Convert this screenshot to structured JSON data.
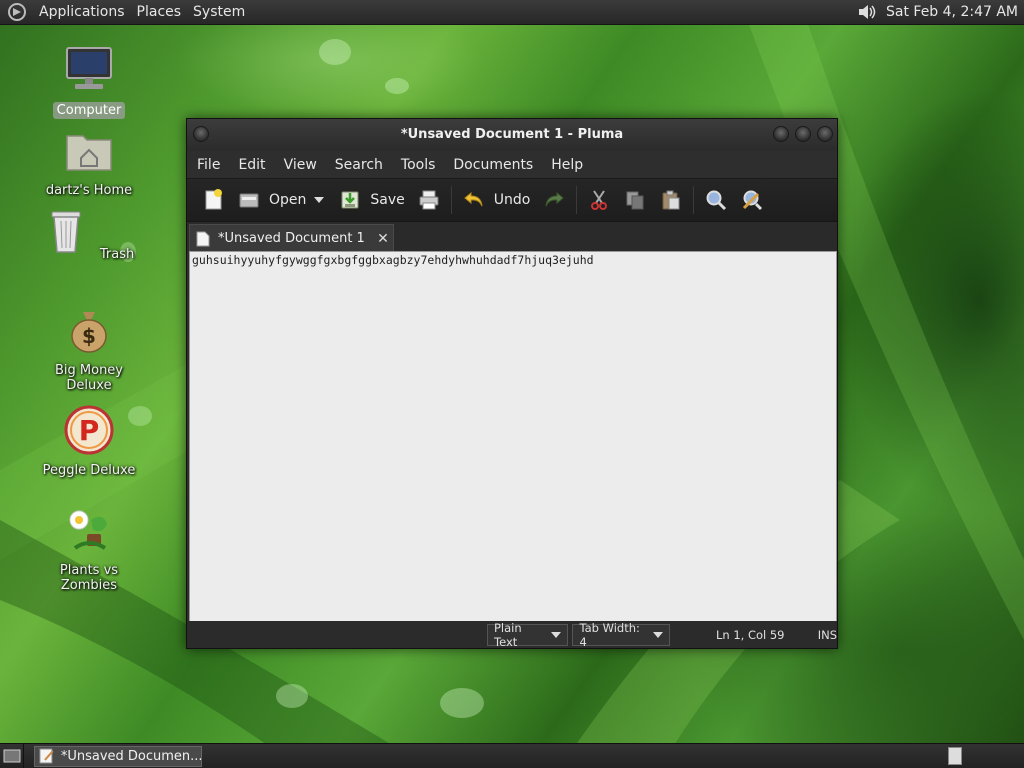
{
  "top_panel": {
    "menus": [
      "Applications",
      "Places",
      "System"
    ],
    "clock": "Sat Feb  4,  2:47 AM"
  },
  "desktop": {
    "icons": [
      {
        "label": "Computer",
        "icon": "computer-icon",
        "selected": true
      },
      {
        "label": "dartz's Home",
        "icon": "home-folder-icon"
      },
      {
        "label": "Trash",
        "icon": "trash-icon"
      },
      {
        "label": "Big Money Deluxe",
        "icon": "money-bag-icon"
      },
      {
        "label": "Peggle Deluxe",
        "icon": "peggle-icon"
      },
      {
        "label": "Plants vs Zombies",
        "icon": "plants-vs-zombies-icon"
      }
    ]
  },
  "window": {
    "title": "*Unsaved Document 1 - Pluma",
    "menu": [
      "File",
      "Edit",
      "View",
      "Search",
      "Tools",
      "Documents",
      "Help"
    ],
    "toolbar": {
      "open_label": "Open",
      "save_label": "Save",
      "undo_label": "Undo"
    },
    "tab": {
      "label": "*Unsaved Document 1",
      "close": "✕"
    },
    "editor_text": "guhsuihyyuhyfgywggfgxbgfggbxagbzy7ehdyhwhuhdadf7hjuq3ejuhd",
    "status": {
      "language": "Plain Text",
      "tab_width": "Tab Width:  4",
      "position": "Ln 1, Col 59",
      "mode": "INS"
    }
  },
  "bottom_panel": {
    "task_label": "*Unsaved Documen..."
  },
  "colors": {
    "panel": "#2b2b2b",
    "editor_bg": "#ececec",
    "accent_green": "#4f9a2e"
  }
}
